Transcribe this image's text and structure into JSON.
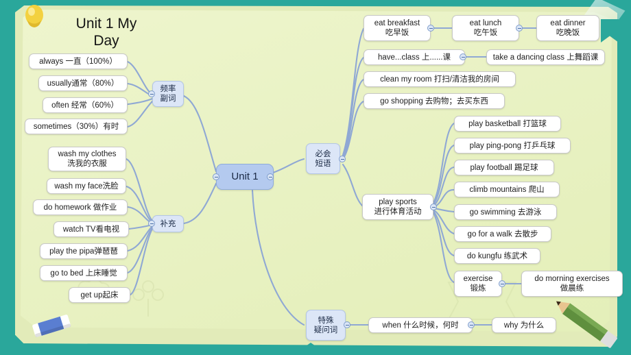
{
  "meta": {
    "title_line1": "Unit 1  My",
    "title_line2": "Day",
    "bg_color": "#2aa79b",
    "paper_color": "#e9f2c4",
    "branch_color": "#c3d3f0",
    "link_color": "#8fa8d4",
    "node_bg": "#ffffff"
  },
  "decorations": [
    {
      "name": "pushpin",
      "color": "#f5d94a"
    },
    {
      "name": "eraser",
      "color": "#5a7ed1"
    },
    {
      "name": "pencil",
      "color": "#5f8f3e"
    }
  ],
  "root": {
    "label": "Unit 1"
  },
  "branches": [
    {
      "id": "frequency",
      "label_line1": "频率",
      "label_line2": "副词",
      "children": [
        {
          "label": "always  一直（100%）"
        },
        {
          "label": "usually通常（80%）"
        },
        {
          "label": "often 经常（60%）"
        },
        {
          "label": "sometimes（30%）有时"
        }
      ]
    },
    {
      "id": "supplement",
      "label_line1": "补充",
      "label_line2": "",
      "children": [
        {
          "label_line1": "wash my clothes",
          "label_line2": "洗我的衣服"
        },
        {
          "label": "wash my face洗脸"
        },
        {
          "label": "do homework 做作业"
        },
        {
          "label": "watch TV看电视"
        },
        {
          "label": "play the pipa弹琶琶"
        },
        {
          "label": "go to bed 上床睡觉"
        },
        {
          "label": "get  up起床"
        }
      ]
    },
    {
      "id": "phrases",
      "label_line1": "必会",
      "label_line2": "短语",
      "children": [
        {
          "label_line1": "eat breakfast",
          "label_line2": "吃早饭",
          "children": [
            {
              "label_line1": "eat  lunch",
              "label_line2": "吃午饭",
              "children": [
                {
                  "label_line1": "eat dinner",
                  "label_line2": "吃晚饭"
                }
              ]
            }
          ]
        },
        {
          "label": "have...class 上......课",
          "children": [
            {
              "label": "take a dancing class 上舞蹈课"
            }
          ]
        },
        {
          "label": "clean my room 打扫/清洁我的房间"
        },
        {
          "label": "go shopping 去购物；去买东西"
        },
        {
          "label_line1": "play sports",
          "label_line2": "进行体育活动",
          "children": [
            {
              "label": "play  basketball 打篮球"
            },
            {
              "label": "play ping-pong 打乒乓球"
            },
            {
              "label": "play football 踢足球"
            },
            {
              "label": "climb mountains 爬山"
            },
            {
              "label": "go swimming 去游泳"
            },
            {
              "label": "go for a walk 去散步"
            },
            {
              "label": "do kungfu 练武术"
            },
            {
              "label_line1": "exercise",
              "label_line2": "锻炼",
              "children": [
                {
                  "label_line1": "do morning exercises",
                  "label_line2": "做晨练"
                }
              ]
            }
          ]
        }
      ]
    },
    {
      "id": "question-words",
      "label_line1": "特殊",
      "label_line2": "疑问词",
      "children": [
        {
          "label": "when 什么时候，何时",
          "children": [
            {
              "label": "why 为什么"
            }
          ]
        }
      ]
    }
  ],
  "nodes_flat": {
    "always": "always  一直（100%）",
    "usually": "usually通常（80%）",
    "often": "often 经常（60%）",
    "sometimes": "sometimes（30%）有时",
    "freq_l1": "频率",
    "freq_l2": "副词",
    "wash_clothes_l1": "wash my clothes",
    "wash_clothes_l2": "洗我的衣服",
    "wash_face": "wash my face洗脸",
    "homework": "do homework 做作业",
    "watch_tv": "watch TV看电视",
    "pipa": "play the pipa弹琶琶",
    "go_to_bed": "go to bed 上床睡觉",
    "get_up": "get  up起床",
    "supplement": "补充",
    "root": "Unit 1",
    "phrases_l1": "必会",
    "phrases_l2": "短语",
    "breakfast_l1": "eat breakfast",
    "breakfast_l2": "吃早饭",
    "lunch_l1": "eat  lunch",
    "lunch_l2": "吃午饭",
    "dinner_l1": "eat dinner",
    "dinner_l2": "吃晚饭",
    "have_class": "have...class 上......课",
    "dancing": "take a dancing class 上舞蹈课",
    "clean_room": "clean my room 打扫/清洁我的房间",
    "shopping": "go shopping 去购物；去买东西",
    "sports_l1": "play sports",
    "sports_l2": "进行体育活动",
    "basketball": "play  basketball 打篮球",
    "pingpong": "play ping-pong 打乒乓球",
    "football": "play football 踢足球",
    "climb": "climb mountains 爬山",
    "swim": "go swimming 去游泳",
    "walk": "go for a walk 去散步",
    "kungfu": "do kungfu 练武术",
    "exercise_l1": "exercise",
    "exercise_l2": "锻炼",
    "morning_l1": "do morning exercises",
    "morning_l2": "做晨练",
    "qw_l1": "特殊",
    "qw_l2": "疑问词",
    "when": "when 什么时候，何时",
    "why": "why 为什么"
  }
}
